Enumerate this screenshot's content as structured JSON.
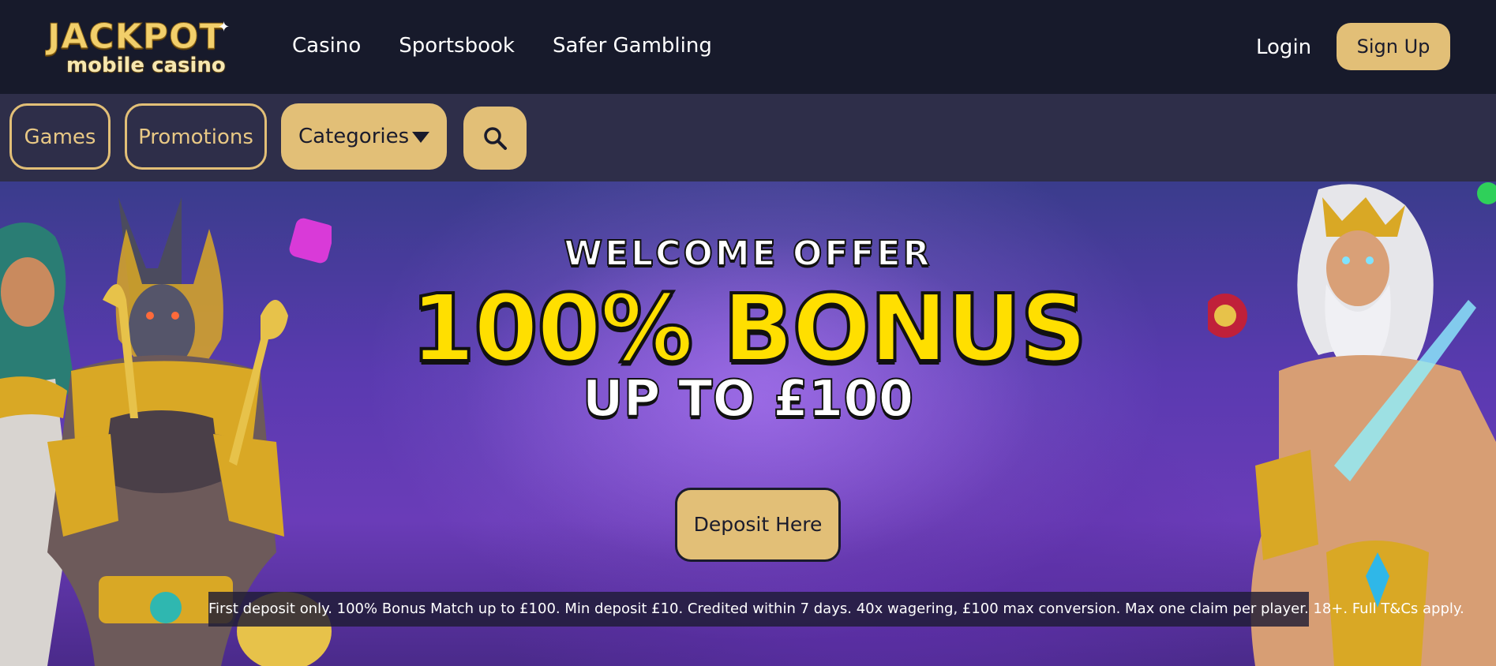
{
  "header": {
    "logo_top": "JACKPOT",
    "logo_bottom": "mobile casino",
    "nav": [
      "Casino",
      "Sportsbook",
      "Safer Gambling"
    ],
    "login_label": "Login",
    "signup_label": "Sign Up"
  },
  "subnav": {
    "games_label": "Games",
    "promotions_label": "Promotions",
    "categories_label": "Categories",
    "search_icon": "search-icon"
  },
  "hero": {
    "line1": "WELCOME OFFER",
    "line2": "100% BONUS",
    "line3": "UP TO £100",
    "deposit_label": "Deposit Here",
    "terms": "First deposit only. 100% Bonus Match up to £100. Min deposit £10. Credited within 7 days. 40x wagering, £100 max conversion. Max one claim per player. 18+. Full T&Cs apply."
  },
  "colors": {
    "header_bg": "#171a2b",
    "subnav_bg": "#2e2e49",
    "accent_gold": "#e2bf77",
    "headline_yellow": "#ffdf00"
  }
}
